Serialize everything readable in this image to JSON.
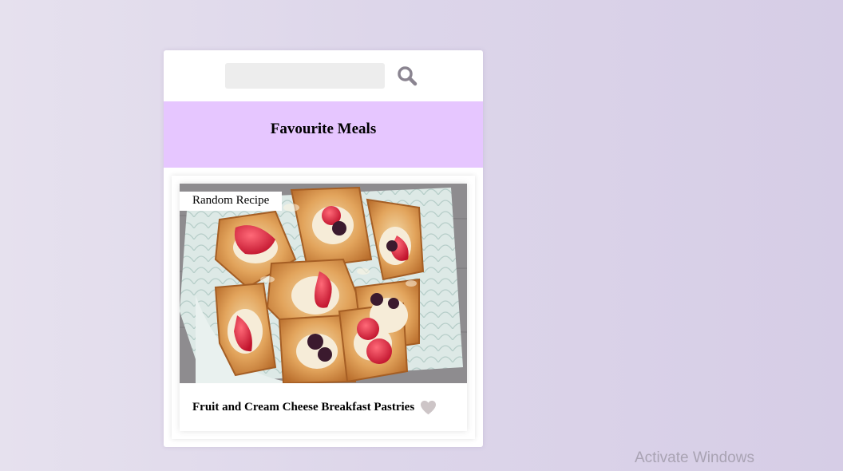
{
  "search": {
    "value": "",
    "placeholder": "",
    "button_icon": "search-icon",
    "icon_color": "#8a8490"
  },
  "favourites": {
    "title": "Favourite Meals",
    "header_color": "#e6c6ff"
  },
  "meal": {
    "tag": "Random Recipe",
    "name": "Fruit and Cream Cheese Breakfast Pastries",
    "image_icon": "pastries-photo",
    "favourite_icon": "heart-icon",
    "favourite_color": "#cdc5c7"
  },
  "os": {
    "watermark": "Activate Windows"
  }
}
